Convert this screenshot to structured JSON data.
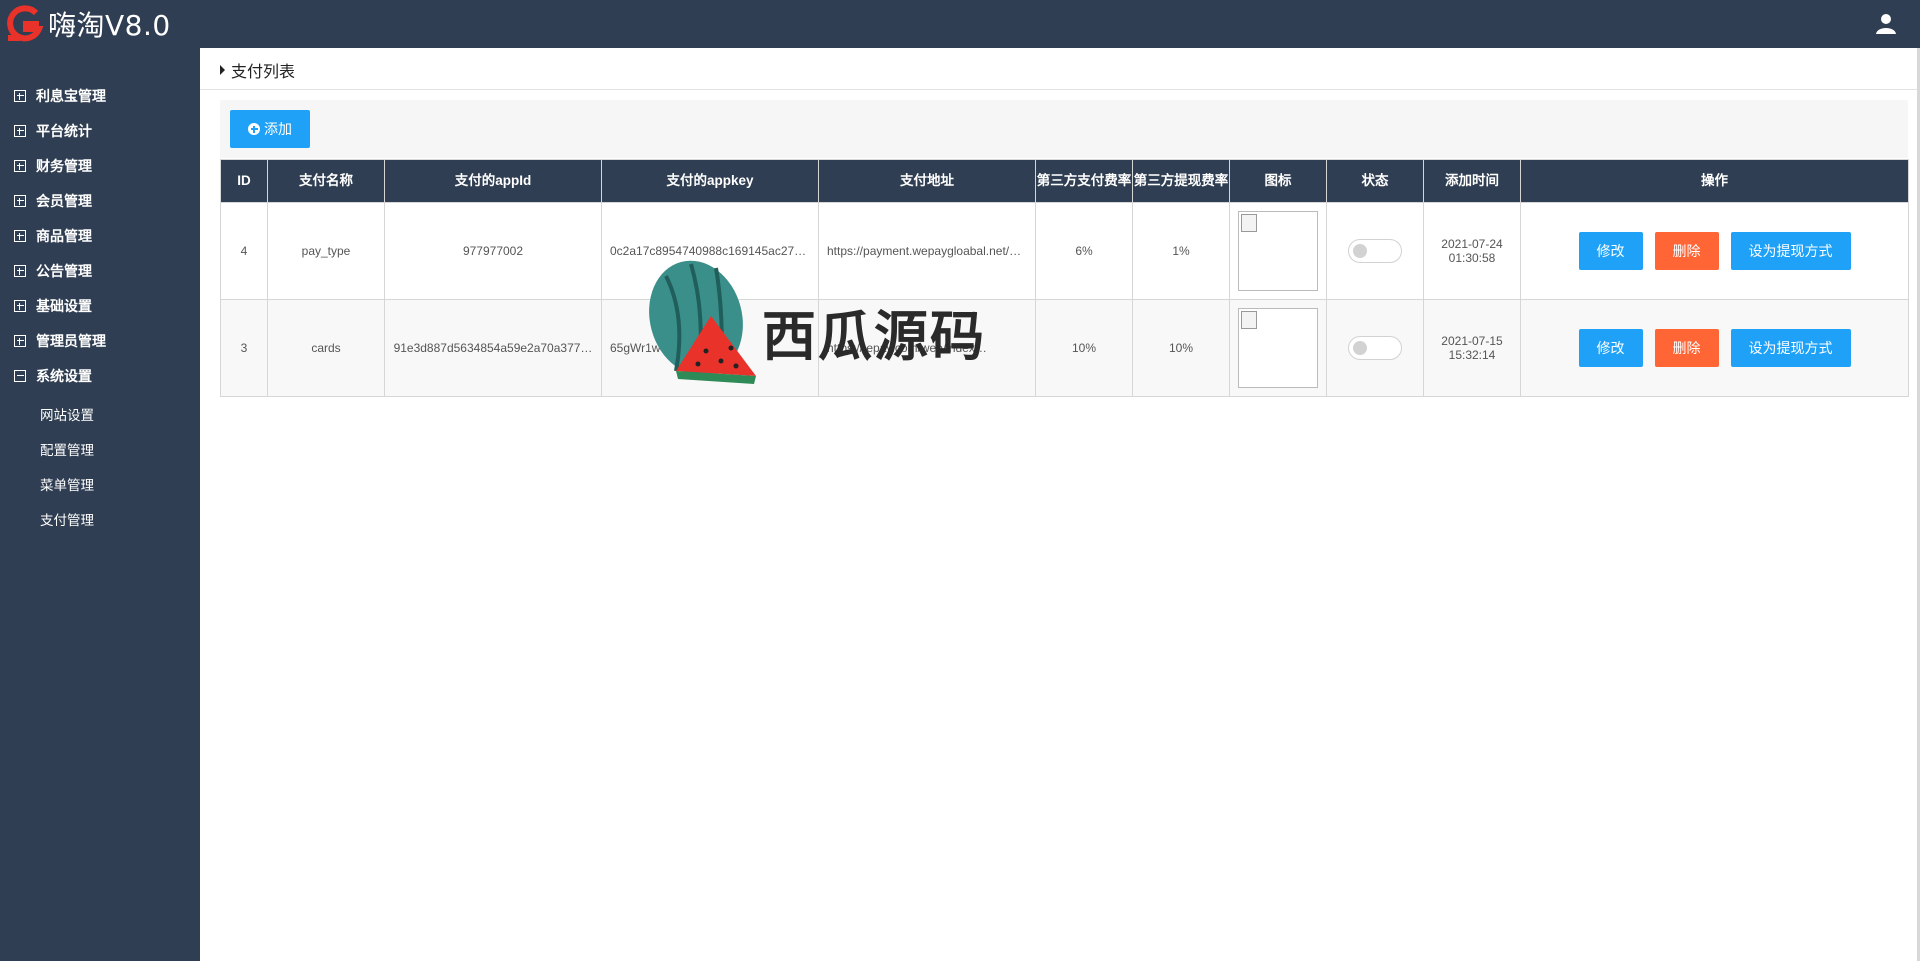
{
  "app": {
    "title": "嗨淘V8.0"
  },
  "sidebar": {
    "groups": [
      {
        "label": "利息宝管理",
        "expanded": false
      },
      {
        "label": "平台统计",
        "expanded": false
      },
      {
        "label": "财务管理",
        "expanded": false
      },
      {
        "label": "会员管理",
        "expanded": false
      },
      {
        "label": "商品管理",
        "expanded": false
      },
      {
        "label": "公告管理",
        "expanded": false
      },
      {
        "label": "基础设置",
        "expanded": false
      },
      {
        "label": "管理员管理",
        "expanded": false
      },
      {
        "label": "系统设置",
        "expanded": true
      }
    ],
    "sub_items": [
      "网站设置",
      "配置管理",
      "菜单管理",
      "支付管理"
    ]
  },
  "main": {
    "title": "支付列表",
    "add_label": "添加"
  },
  "table": {
    "headers": [
      "ID",
      "支付名称",
      "支付的appId",
      "支付的appkey",
      "支付地址",
      "第三方支付费率",
      "第三方提现费率",
      "图标",
      "状态",
      "添加时间",
      "操作"
    ],
    "rows": [
      {
        "id": "4",
        "name": "pay_type",
        "appid": "977977002",
        "appkey": "0c2a17c8954740988c169145ac27…",
        "url": "https://payment.wepaygloabal.net/…",
        "pay_rate": "6%",
        "withdraw_rate": "1%",
        "status_on": false,
        "date": "2021-07-24",
        "time": "01:30:58"
      },
      {
        "id": "3",
        "name": "cards",
        "appid": "91e3d887d5634854a59e2a70a377…",
        "appkey": "65gWr1w            54y35",
        "url": "https://      epay.com/web/index…",
        "pay_rate": "10%",
        "withdraw_rate": "10%",
        "status_on": false,
        "date": "2021-07-15",
        "time": "15:32:14"
      }
    ],
    "actions": {
      "edit": "修改",
      "delete": "删除",
      "set_withdraw": "设为提现方式"
    }
  },
  "watermark": {
    "text": "西瓜源码"
  },
  "colors": {
    "sidebar_bg": "#2f3e52",
    "primary": "#1fa1f7",
    "danger": "#ff6535",
    "logo_red": "#e8322a"
  }
}
